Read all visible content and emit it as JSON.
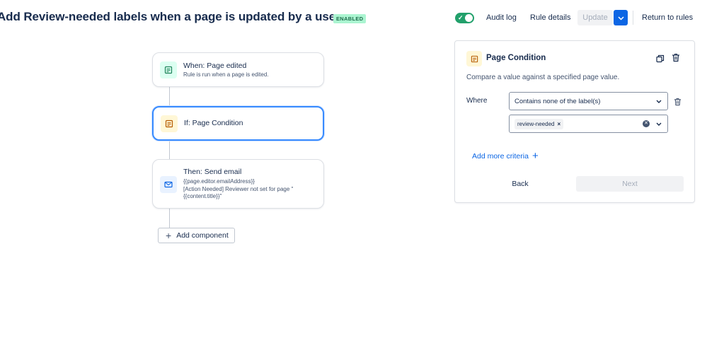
{
  "header": {
    "title": "Add Review-needed labels when a page is updated by a user",
    "status_badge": "ENABLED",
    "toggle_enabled": true,
    "audit_log": "Audit log",
    "rule_details": "Rule details",
    "update": "Update",
    "return_to_rules": "Return to rules"
  },
  "flow": {
    "trigger": {
      "title": "When: Page edited",
      "description": "Rule is run when a page is edited."
    },
    "condition": {
      "title": "If: Page Condition"
    },
    "action": {
      "title": "Then: Send email",
      "line1": "{{page.editor.emailAddress}}",
      "line2": "[Action Needed] Reviewer not set for page \"{{content.title}}\""
    },
    "add_component": "Add component"
  },
  "panel": {
    "title": "Page Condition",
    "description": "Compare a value against a specified page value.",
    "where_label": "Where",
    "operator_value": "Contains none of the label(s)",
    "labels": [
      "review-needed"
    ],
    "add_more_criteria": "Add more criteria",
    "back": "Back",
    "next": "Next"
  },
  "colors": {
    "accent": "#0c66e4",
    "enabled_green": "#22a06b",
    "selected_border": "#388bff"
  },
  "icons": {
    "trigger": "page-edit-icon",
    "condition": "page-condition-icon",
    "action": "email-icon",
    "copy": "copy-icon",
    "delete": "trash-icon"
  }
}
